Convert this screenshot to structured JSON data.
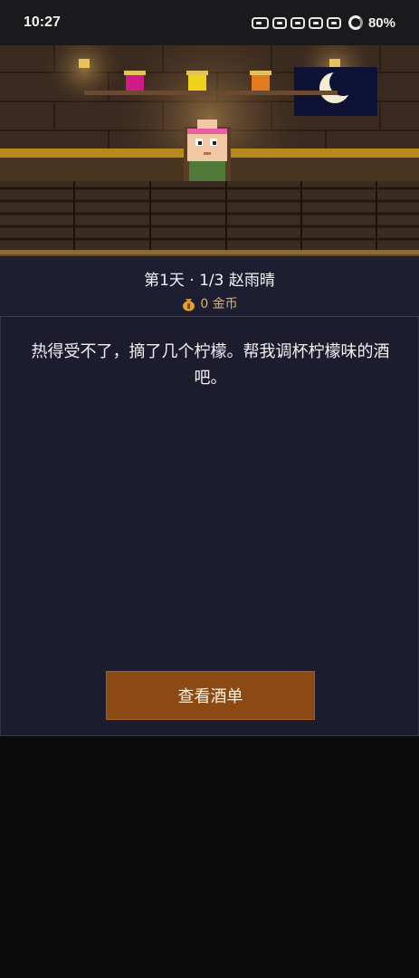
{
  "status_bar": {
    "time": "10:27",
    "battery": "80%",
    "icons": [
      "notification-icon",
      "notification-icon",
      "notification-icon",
      "notification-icon",
      "notification-icon",
      "battery-ring-icon"
    ]
  },
  "scene": {
    "shelf_bottles": [
      "magenta-jar-icon",
      "yellow-jar-icon",
      "orange-jar-icon"
    ],
    "window": "night-window-moon",
    "character": "bartender-customer"
  },
  "info": {
    "title": "第1天 · 1/3 赵雨晴",
    "coins": "0 金币",
    "coin_icon": "money-bag-icon"
  },
  "dialog": {
    "speech": "热得受不了，摘了几个柠檬。帮我调杯柠檬味的酒吧。",
    "button_label": "查看酒单"
  },
  "colors": {
    "panel": "#1d1c2f",
    "button": "#8b4a14",
    "coin_text": "#d9b46a"
  }
}
